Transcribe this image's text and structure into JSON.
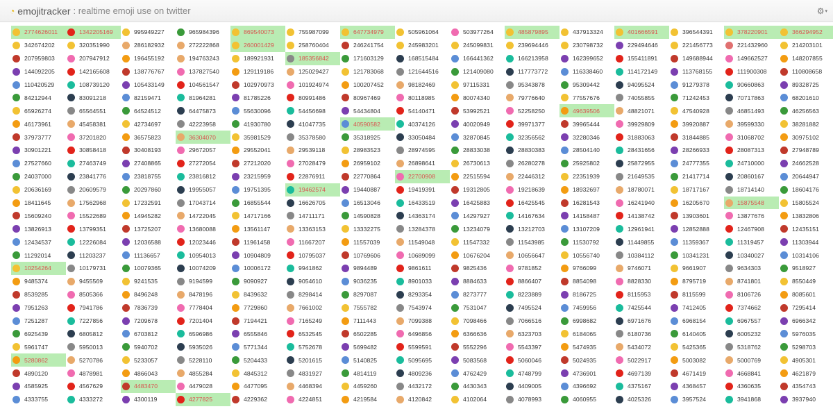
{
  "header": {
    "brand_name": "emojitracker",
    "brand_sub": ": realtime emoji use on twitter",
    "settings_icon": "gear-icon"
  },
  "cells": [
    "2774626011",
    "1342205169",
    "995949227",
    "965984396",
    "869540073",
    "755987099",
    "647734979",
    "505961064",
    "503977264",
    "485879895",
    "437913324",
    "401666591",
    "396544391",
    "378220901",
    "366294952",
    "342674202",
    "320351990",
    "286182932",
    "272222868",
    "260001429",
    "258760404",
    "246241754",
    "245983201",
    "245099831",
    "239694446",
    "230798732",
    "229494646",
    "221456773",
    "221432960",
    "214203101",
    "207959803",
    "207947912",
    "196455192",
    "194763243",
    "189921931",
    "185356842",
    "171603129",
    "168515484",
    "166441362",
    "166213958",
    "162399652",
    "155411891",
    "149688944",
    "149662527",
    "148207855",
    "144092205",
    "142165608",
    "138776767",
    "137827540",
    "129119186",
    "125029427",
    "121783068",
    "121644516",
    "121409080",
    "117773772",
    "116338460",
    "114172149",
    "113768155",
    "111900308",
    "110808658",
    "110420529",
    "108739120",
    "105433149",
    "104561547",
    "102970973",
    "101924974",
    "100207452",
    "98182469",
    "97115331",
    "95343878",
    "95309442",
    "94095524",
    "91279378",
    "90660863",
    "89328725",
    "84212944",
    "83091218",
    "82159471",
    "81964281",
    "81785226",
    "80991486",
    "80967469",
    "80118985",
    "80074340",
    "79776640",
    "77557676",
    "74055855",
    "71242453",
    "70717863",
    "68201610",
    "65926274",
    "65564551",
    "64524512",
    "64475873",
    "55630096",
    "54456698",
    "54434804",
    "54140471",
    "53992521",
    "52258250",
    "49639506",
    "48821071",
    "47540928",
    "46851493",
    "46256563",
    "46173961",
    "45458381",
    "42734697",
    "42223958",
    "41930780",
    "41047735",
    "40590582",
    "40374126",
    "40020949",
    "39971377",
    "39965444",
    "39929809",
    "39920887",
    "39599330",
    "38281882",
    "37973777",
    "37201820",
    "36575823",
    "36304070",
    "35981529",
    "35378580",
    "35318925",
    "33050484",
    "32870845",
    "32356562",
    "32280346",
    "31883063",
    "31844885",
    "31068702",
    "30975102",
    "30901221",
    "30858418",
    "30408193",
    "29672057",
    "29552041",
    "29539118",
    "28983523",
    "28974595",
    "28833038",
    "28830383",
    "28504140",
    "28431656",
    "28266933",
    "28087313",
    "27948789",
    "27527660",
    "27463749",
    "27408865",
    "27272054",
    "27212020",
    "27028479",
    "26959102",
    "26898641",
    "26730613",
    "26280278",
    "25925802",
    "25872955",
    "24777355",
    "24710000",
    "24662528",
    "24037000",
    "23841776",
    "23818755",
    "23816812",
    "23215959",
    "22876911",
    "22770864",
    "22700908",
    "22515594",
    "22446312",
    "22351939",
    "21649535",
    "21417714",
    "20860167",
    "20644947",
    "20636169",
    "20609579",
    "20297860",
    "19955057",
    "19751395",
    "19462574",
    "19440887",
    "19419391",
    "19312805",
    "19218639",
    "18932697",
    "18780071",
    "18717167",
    "18714140",
    "18604176",
    "18411645",
    "17562968",
    "17232591",
    "17043714",
    "16855544",
    "16626705",
    "16513046",
    "16433519",
    "16425883",
    "16425545",
    "16281543",
    "16241940",
    "16205670",
    "15875548",
    "15805524",
    "15609240",
    "15522689",
    "14945282",
    "14722045",
    "14717166",
    "14711171",
    "14590828",
    "14363174",
    "14297927",
    "14167634",
    "14158487",
    "14138742",
    "13903601",
    "13877676",
    "13832806",
    "13826913",
    "13799351",
    "13725207",
    "13680088",
    "13561147",
    "13363153",
    "13332275",
    "13284378",
    "13234079",
    "13212703",
    "13107209",
    "12961941",
    "12852888",
    "12467908",
    "12435151",
    "12434537",
    "12226084",
    "12036588",
    "12023446",
    "11961458",
    "11667207",
    "11557039",
    "11549048",
    "11547332",
    "11543985",
    "11530792",
    "11449855",
    "11359367",
    "11319457",
    "11303944",
    "11292014",
    "11203237",
    "11136657",
    "10954013",
    "10904809",
    "10795037",
    "10769606",
    "10689099",
    "10676204",
    "10656647",
    "10556740",
    "10384112",
    "10341231",
    "10340027",
    "10314106",
    "10254264",
    "10179731",
    "10079365",
    "10074209",
    "10006172",
    "9941862",
    "9894489",
    "9861611",
    "9825436",
    "9781852",
    "9766099",
    "9746071",
    "9661907",
    "9634303",
    "9518927",
    "9485374",
    "9455569",
    "9241535",
    "9194599",
    "9090927",
    "9054610",
    "9036235",
    "8901033",
    "8884633",
    "8866407",
    "8854098",
    "8828330",
    "8795719",
    "8741801",
    "8550449",
    "8539285",
    "8505366",
    "8496248",
    "8478196",
    "8439632",
    "8298414",
    "8297087",
    "8293354",
    "8273777",
    "8223889",
    "8186725",
    "8115953",
    "8115599",
    "8106726",
    "8085601",
    "7951263",
    "7941786",
    "7836739",
    "7778404",
    "7729860",
    "7661002",
    "7555782",
    "7543974",
    "7531047",
    "7495524",
    "7459956",
    "7425544",
    "7412405",
    "7374662",
    "7295414",
    "7251287",
    "7227856",
    "7209678",
    "7201404",
    "7194421",
    "7165249",
    "7111443",
    "7099388",
    "7098466",
    "7066516",
    "6998682",
    "6971676",
    "6968154",
    "6967557",
    "6966342",
    "6925439",
    "6805812",
    "6703812",
    "6596986",
    "6555846",
    "6532545",
    "6502285",
    "6496856",
    "6366636",
    "6323703",
    "6184065",
    "6180736",
    "6140405",
    "6005232",
    "5976035",
    "5961747",
    "5950013",
    "5940702",
    "5935026",
    "5771344",
    "5752678",
    "5699482",
    "5599591",
    "5552296",
    "5543397",
    "5474935",
    "5434072",
    "5425365",
    "5318762",
    "5298703",
    "5280862",
    "5270786",
    "5233057",
    "5228110",
    "5204433",
    "5201615",
    "5140825",
    "5095695",
    "5083568",
    "5060046",
    "5024935",
    "5022917",
    "5003082",
    "5000769",
    "4905301",
    "4890120",
    "4878981",
    "4866043",
    "4855284",
    "4845312",
    "4831927",
    "4814119",
    "4809236",
    "4762429",
    "4748799",
    "4736901",
    "4697139",
    "4671419",
    "4668841",
    "4621879",
    "4585925",
    "4567629",
    "4483470",
    "4479028",
    "4477095",
    "4468394",
    "4459260",
    "4432172",
    "4430343",
    "4409005",
    "4396692",
    "4375167",
    "4368457",
    "4360635",
    "4354743",
    "4333755",
    "4333272",
    "4300119",
    "4277825",
    "4229362",
    "4224851",
    "4219584",
    "4120842",
    "4102064",
    "4078993",
    "4060955",
    "4025326",
    "3957524",
    "3941868",
    "3937940"
  ],
  "highlight_bright": [
    0,
    1,
    4,
    6,
    9,
    11,
    13,
    14,
    19,
    35,
    100,
    111,
    123,
    172,
    185,
    208,
    270,
    375,
    407,
    423
  ],
  "highlight_light": [
    15,
    16,
    17,
    18,
    19,
    20,
    21,
    22,
    23,
    24,
    25,
    26,
    27,
    28,
    29,
    47,
    50,
    60,
    75,
    76,
    77,
    87,
    92,
    96,
    101,
    135,
    161,
    177,
    184,
    289,
    279,
    317,
    333,
    392
  ],
  "emoji_colors": [
    "#f2c233",
    "#e2231a",
    "#f2c233",
    "#3a9a3a",
    "#f2c233",
    "#f2c233",
    "#f2c233",
    "#f2c233",
    "#f06bb0",
    "#f2c233",
    "#f2c233",
    "#f2c233",
    "#f2c233",
    "#f2c233",
    "#f2c233",
    "#f2c233",
    "#f2c233",
    "#e8a96a",
    "#e8a96a",
    "#f2c233",
    "#f2c233",
    "#c0392b",
    "#f2c233",
    "#f2c233",
    "#f2c233",
    "#f2c233",
    "#7b3fb0",
    "#f2c233",
    "#e07070",
    "#f2c233"
  ]
}
